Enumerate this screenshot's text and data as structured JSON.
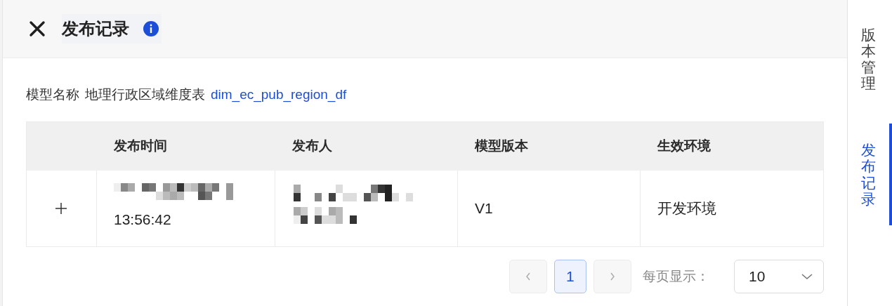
{
  "header": {
    "title": "发布记录"
  },
  "model": {
    "label": "模型名称",
    "name": "地理行政区域维度表",
    "code": "dim_ec_pub_region_df"
  },
  "table": {
    "columns": [
      "发布时间",
      "发布人",
      "模型版本",
      "生效环境"
    ],
    "rows": [
      {
        "expanded": false,
        "time": "13:56:42",
        "version": "V1",
        "environment": "开发环境"
      }
    ]
  },
  "pagination": {
    "prev_disabled": true,
    "next_disabled": true,
    "pages": [
      {
        "label": "1",
        "selected": true
      }
    ],
    "page_size_label": "每页显示：",
    "page_size": "10"
  },
  "side_tabs": [
    {
      "label": "版本管理",
      "selected": false
    },
    {
      "label": "发布记录",
      "selected": true
    }
  ]
}
